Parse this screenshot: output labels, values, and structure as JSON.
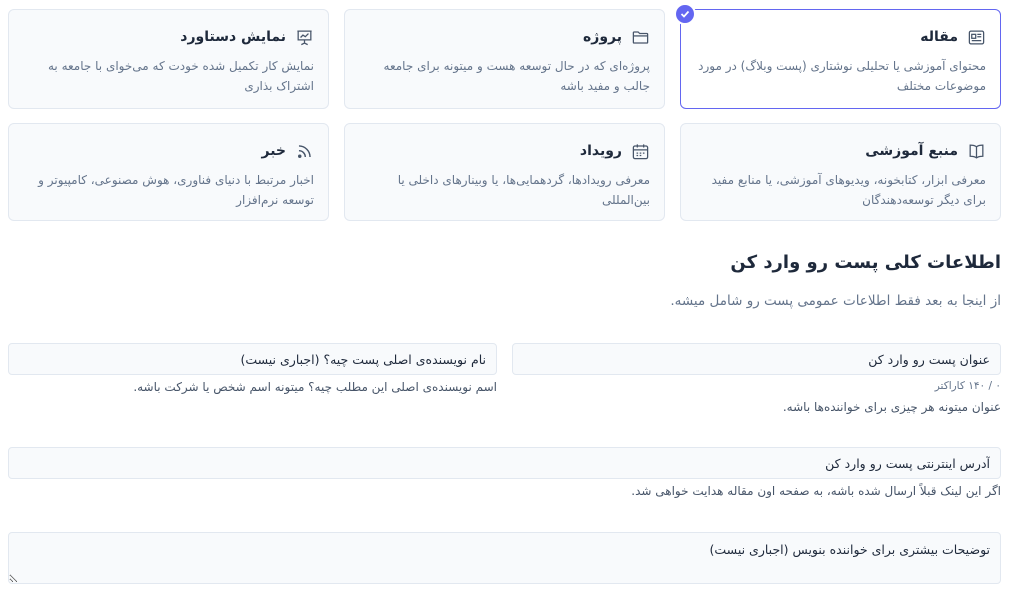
{
  "types": [
    {
      "title": "مقاله",
      "icon": "article-icon",
      "description": "محتوای آموزشی یا تحلیلی نوشتاری (پست وبلاگ) در مورد موضوعات مختلف",
      "selected": true
    },
    {
      "title": "پروژه",
      "icon": "folder-icon",
      "description": "پروژه‌ای که در حال توسعه هست و میتونه برای جامعه جالب و مفید باشه",
      "selected": false
    },
    {
      "title": "نمایش دستاورد",
      "icon": "presentation-chart-icon",
      "description": "نمایش کار تکمیل شده خودت که می‌خوای با جامعه به اشتراک بذاری",
      "selected": false
    },
    {
      "title": "منبع آموزشی",
      "icon": "book-icon",
      "description": "معرفی ابزار، کتابخونه، ویدیوهای آموزشی، یا منابع مفید برای دیگر توسعه‌دهندگان",
      "selected": false
    },
    {
      "title": "رویداد",
      "icon": "calendar-icon",
      "description": "معرفی رویدادها، گردهمایی‌ها، یا وبینارهای داخلی یا بین‌المللی",
      "selected": false
    },
    {
      "title": "خبر",
      "icon": "rss-icon",
      "description": "اخبار مرتبط با دنیای فناوری، هوش مصنوعی، کامپیوتر و توسعه نرم‌افزار",
      "selected": false
    }
  ],
  "colors": {
    "accent": "#6366f1",
    "border": "#e2e8f0",
    "field_bg": "#f8fafc"
  },
  "section": {
    "title": "اطلاعات کلی پست رو وارد کن",
    "subtitle": "از اینجا به بعد فقط اطلاعات عمومی پست رو شامل میشه."
  },
  "form": {
    "title_placeholder": "عنوان پست رو وارد کن",
    "title_value": "",
    "title_counter": "۰ / ۱۴۰ کاراکتر",
    "title_hint": "عنوان میتونه هر چیزی برای خواننده‌ها باشه.",
    "author_placeholder": "نام نویسنده‌ی اصلی پست چیه؟ (اجباری نیست)",
    "author_value": "",
    "author_hint": "اسم نویسنده‌ی اصلی این مطلب چیه؟ میتونه اسم شخص یا شرکت باشه.",
    "url_placeholder": "آدرس اینترنتی پست رو وارد کن",
    "url_value": "",
    "url_hint": "اگر این لینک قبلاً ارسال شده باشه، به صفحه اون مقاله هدایت خواهی شد.",
    "description_placeholder": "توضیحات بیشتری برای خواننده بنویس (اجباری نیست)",
    "description_value": ""
  }
}
